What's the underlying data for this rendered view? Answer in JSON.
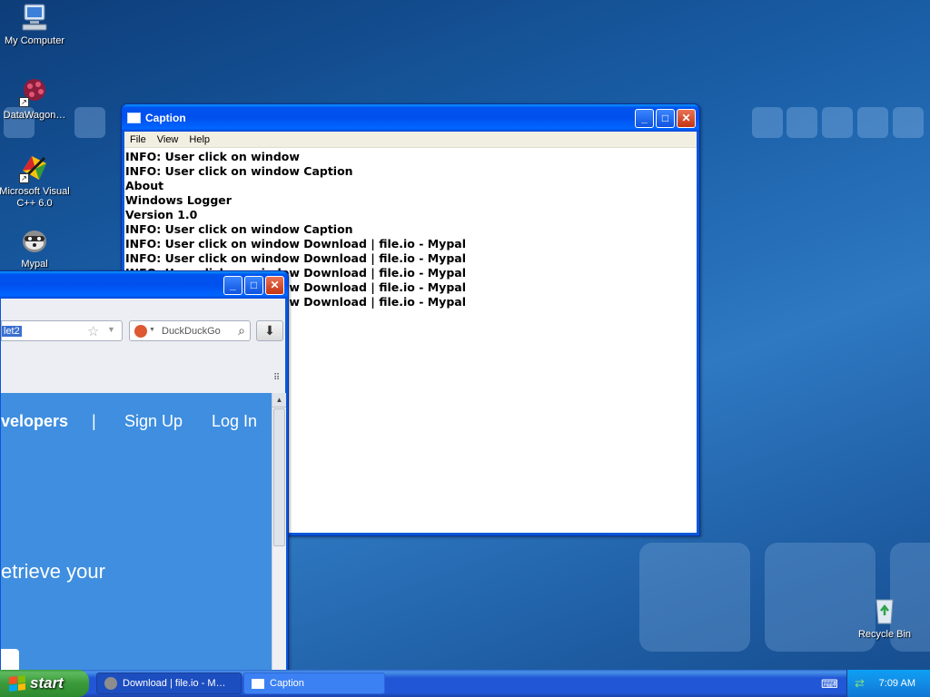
{
  "desktop": {
    "icons": [
      {
        "label": "My Computer",
        "icon": "my-computer-icon"
      },
      {
        "label": "DataWagon…",
        "icon": "datawagon-icon"
      },
      {
        "label": "Microsoft Visual C++ 6.0",
        "icon": "visual-cpp-icon"
      },
      {
        "label": "Mypal",
        "icon": "mypal-icon"
      },
      {
        "label": "Recycle Bin",
        "icon": "recycle-bin-icon"
      }
    ]
  },
  "caption_window": {
    "title": "Caption",
    "menu": [
      "File",
      "View",
      "Help"
    ],
    "log_lines": [
      "INFO: User click on window",
      "INFO: User click on window Caption",
      "About",
      "Windows Logger",
      "Version 1.0",
      "INFO: User click on window Caption",
      "INFO: User click on window Download | file.io - Mypal",
      "INFO: User click on window Download | file.io - Mypal",
      "INFO: User click on window Download | file.io - Mypal",
      "INFO: User click on window Download | file.io - Mypal",
      "INFO: User click on window Download | file.io - Mypal"
    ]
  },
  "browser_window": {
    "url_fragment": "let2",
    "search_placeholder": "DuckDuckGo",
    "nav": {
      "developers": "velopers",
      "divider": "|",
      "signup": "Sign Up",
      "login": "Log In"
    },
    "hero_text": "etrieve your"
  },
  "taskbar": {
    "start_label": "start",
    "tasks": [
      {
        "label": "Download | file.io - M…",
        "icon": "mypal-icon"
      },
      {
        "label": "Caption",
        "icon": "window-icon"
      }
    ],
    "clock": "7:09 AM"
  },
  "colors": {
    "desktop": "#1a5fa8",
    "title_bar": "#0053ee",
    "close_button": "#c33412",
    "page_blue": "#3f8ee0",
    "start_green": "#3a9a3a"
  }
}
